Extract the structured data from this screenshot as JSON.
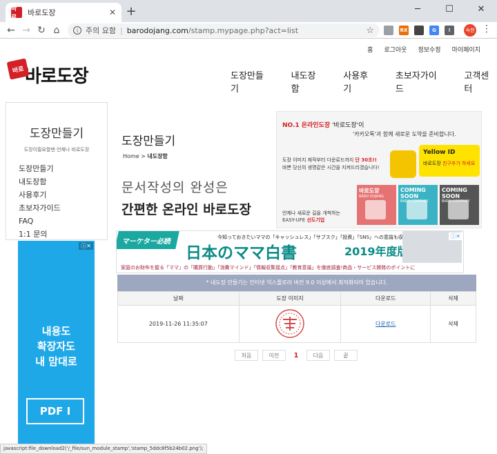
{
  "browser": {
    "tab_title": "바로도장",
    "tab_favicon": "바로",
    "security_text": "주의 요함",
    "url_host": "barodojang.com",
    "url_path": "/stamp.mypage.php?act=list",
    "profile": "숙현",
    "extensions": [
      {
        "name": "ext-icon-1",
        "label": "",
        "color": "#9aa0a6"
      },
      {
        "name": "ext-icon-2",
        "label": "RX",
        "color": "#e8710a"
      },
      {
        "name": "ext-icon-3",
        "label": "",
        "color": "#444444"
      },
      {
        "name": "ext-icon-4",
        "label": "G",
        "color": "#4285f4"
      },
      {
        "name": "ext-icon-5",
        "label": "!",
        "color": "#5f6368"
      }
    ]
  },
  "site": {
    "topnav": [
      "홈",
      "로그아웃",
      "정보수정",
      "마이페이지"
    ],
    "logo_mark": "바로",
    "logo_text": "바로도장",
    "mainnav": [
      "도장만들기",
      "내도장함",
      "사용후기",
      "초보자가이드",
      "고객센터"
    ]
  },
  "sidebar": {
    "title": "도장만들기",
    "subtitle": "도장이필요할땐 언제나 바로도장",
    "items": [
      "도장만들기",
      "내도장함",
      "사용후기",
      "초보자가이드",
      "FAQ",
      "1:1 문의"
    ]
  },
  "ad_left": {
    "line1": "내용도",
    "line2": "확장자도",
    "line3": "내 맘대로",
    "pdf": "PDF"
  },
  "content": {
    "title": "도장만들기",
    "breadcrumb_home": "Home",
    "breadcrumb_current": "내도장함",
    "slogan1": "문서작성의 완성은",
    "slogan2": "간편한 온라인 바로도장"
  },
  "promo": {
    "no1": "NO.1 온라인도장",
    "tagline1": "'바로도장'이",
    "tagline2": "'카카오톡'과 함께 새로운 도약을 준비합니다.",
    "desc1a": "도장 이미지 제작부터 다운로드까지 ",
    "desc1b": "단 30초!!",
    "desc2": "바쁜 당신의 생명같은 시간을 지켜드리겠습니다!",
    "yellowid": "Yellow ID",
    "yellowid_sub_a": "바로도장 ",
    "yellowid_sub_b": "친구추가 하세요",
    "footer1": "언제나 새로운 길을 개척하는",
    "footer2a": "EASY-UFE ",
    "footer2b": "선도기업",
    "cards": [
      {
        "title": "바로도장",
        "sub": "BARO DOJANG",
        "color": "#e57373"
      },
      {
        "title": "COMING SOON",
        "sub": "BARO COMPANY",
        "color": "#3bb3c4"
      },
      {
        "title": "COMING SOON",
        "sub": "BARO COMPANY",
        "color": "#555555"
      }
    ]
  },
  "banner": {
    "ribbon": "マーケター必読",
    "line1": "今知っておきたいママの「キャッシュレス」「サブスク」「投資」「SNS」への意識も収録",
    "headline": "日本のママ白書",
    "year": "2019年度版",
    "bottom": "家庭のお財布を握る「ママ」の「購買行動」「消費マインド」「情報収集接点」「教育意識」を徹底調査!商品・サービス開発のポイントに"
  },
  "notice": "* 내도장 만들기는 인터넷 익스플로러 버전 9.0 이상에서 최적화되어 있습니다.",
  "table": {
    "headers": [
      "날짜",
      "도장 이미지",
      "다운로드",
      "삭제"
    ],
    "rows": [
      {
        "date": "2019-11-26 11:35:07",
        "download": "다운로드",
        "delete": "삭제"
      }
    ]
  },
  "pager": {
    "first": "처음",
    "prev": "이전",
    "current": "1",
    "next": "다음",
    "last": "끝"
  },
  "statusbar": "javascript:file_download2('/_file/sun_module_stamp','stamp_5ddc8f5b24b02.png');"
}
